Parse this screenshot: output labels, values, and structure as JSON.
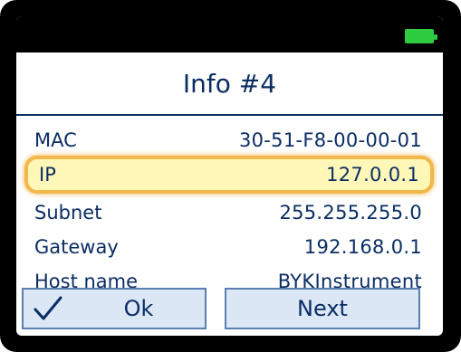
{
  "screen": {
    "title": "Info #4",
    "battery_icon": "battery-full-icon",
    "battery_color": "#2ecc40"
  },
  "rows": [
    {
      "label": "MAC",
      "value": "30-51-F8-00-00-01"
    },
    {
      "label": "IP",
      "value": "127.0.0.1"
    },
    {
      "label": "Subnet",
      "value": "255.255.255.0"
    },
    {
      "label": "Gateway",
      "value": "192.168.0.1"
    },
    {
      "label": "Host name",
      "value": "BYKInstrument"
    }
  ],
  "buttons": {
    "ok_label": "Ok",
    "ok_icon": "checkmark-icon",
    "next_label": "Next"
  },
  "colors": {
    "text": "#0b2d63",
    "highlight_fill": "#fff7b8",
    "highlight_border": "#f2b84b",
    "button_fill": "#dbe7f5"
  }
}
